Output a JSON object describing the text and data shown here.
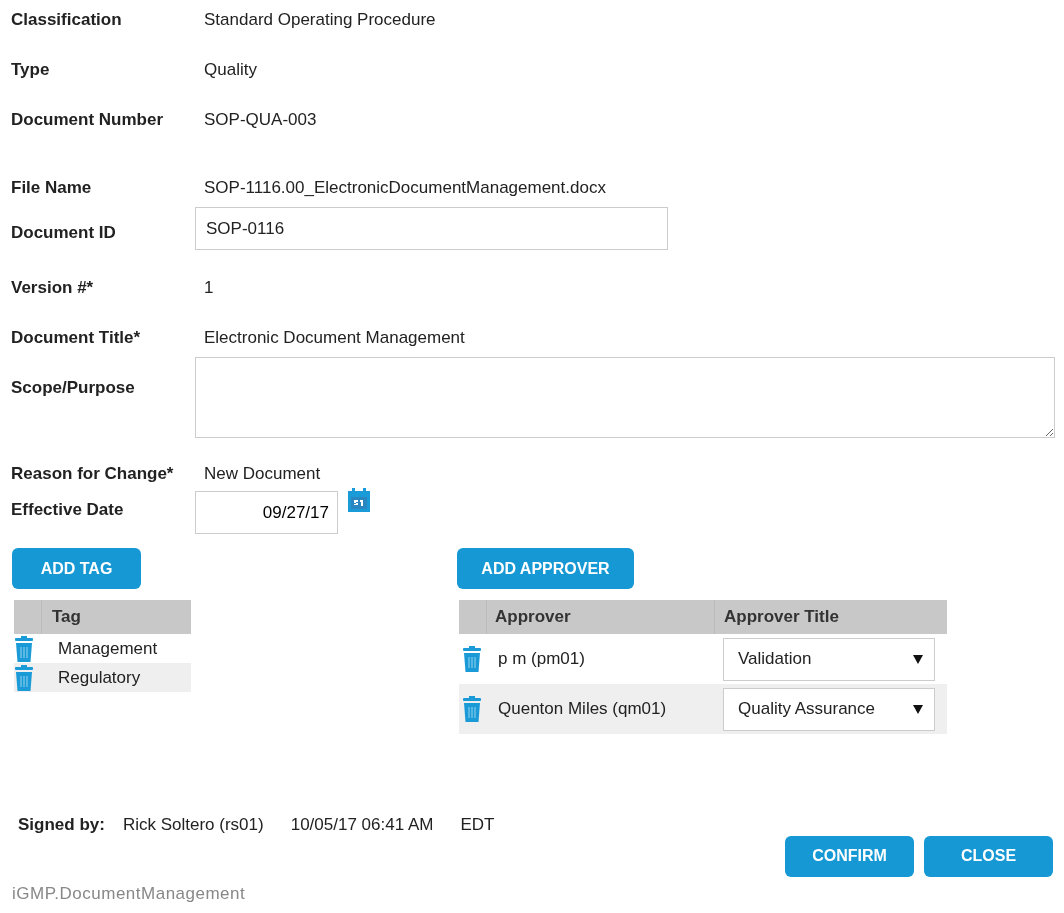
{
  "fields": [
    {
      "kind": "text",
      "label": "Classification",
      "value": "Standard Operating Procedure"
    },
    {
      "kind": "text",
      "label": "Type",
      "value": "Quality"
    },
    {
      "kind": "text",
      "label": "Document Number",
      "value": "SOP-QUA-003"
    },
    {
      "kind": "text",
      "label": "File Name",
      "value": "SOP-1116.00_ElectronicDocumentManagement.docx"
    },
    {
      "kind": "input",
      "label": "Document ID",
      "value": "SOP-0116"
    },
    {
      "kind": "text",
      "label": "Version #*",
      "value": "1"
    },
    {
      "kind": "text",
      "label": "Document Title*",
      "value": "Electronic Document Management"
    },
    {
      "kind": "textarea",
      "label": "Scope/Purpose"
    },
    {
      "kind": "text",
      "label": "Reason for Change*",
      "value": "New Document"
    },
    {
      "kind": "date",
      "label": "Effective Date",
      "value": "09/27/17"
    }
  ],
  "tags": {
    "button": "ADD TAG",
    "column": "Tag",
    "rows": [
      {
        "name": "Management"
      },
      {
        "name": "Regulatory"
      }
    ]
  },
  "approvers": {
    "button": "ADD APPROVER",
    "columns": [
      "Approver",
      "Approver Title"
    ],
    "rows": [
      {
        "name": "p m (pm01)",
        "title": "Validation"
      },
      {
        "name": "Quenton Miles (qm01)",
        "title": "Quality Assurance"
      }
    ]
  },
  "signature": {
    "label": "Signed by:",
    "name": "Rick Soltero (rs01)",
    "datetime": "10/05/17 06:41 AM",
    "zone": "EDT"
  },
  "buttons": [
    "CONFIRM",
    "CLOSE"
  ],
  "footer": "iGMP.DocumentManagement"
}
